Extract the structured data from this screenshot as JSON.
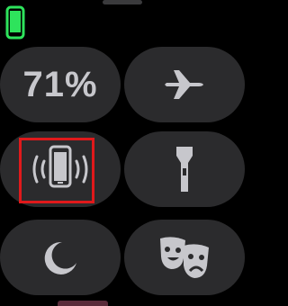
{
  "status": {
    "icon": "phone-connected-icon",
    "color": "#2ee35c"
  },
  "tiles": {
    "battery": {
      "label": "71%"
    },
    "airplane": {
      "icon": "airplane-icon"
    },
    "ping_phone": {
      "icon": "ping-phone-icon"
    },
    "flashlight": {
      "icon": "flashlight-icon"
    },
    "do_not_disturb": {
      "icon": "moon-icon"
    },
    "theater_mode": {
      "icon": "theater-masks-icon"
    }
  },
  "colors": {
    "tile_bg": "#2b2b2d",
    "icon": "#c7c7cc",
    "highlight": "#e0191b"
  }
}
